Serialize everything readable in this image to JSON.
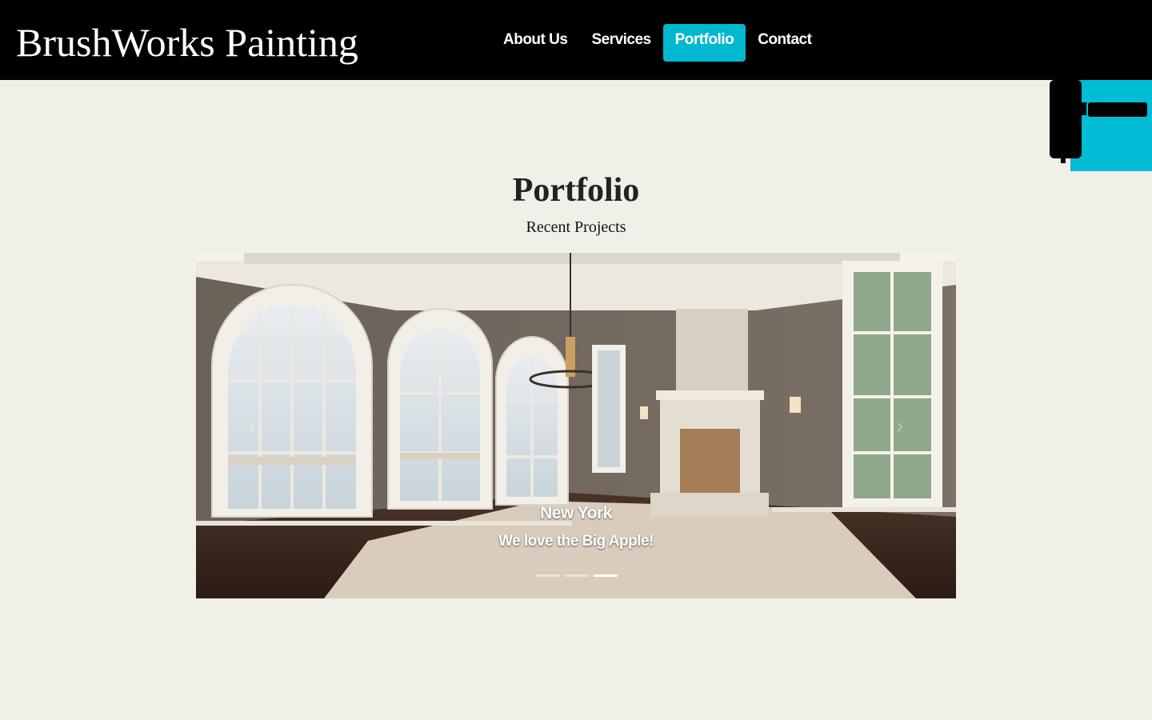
{
  "brand": {
    "name": "BrushWorks Painting"
  },
  "nav": {
    "items": [
      {
        "label": "About Us",
        "active": false
      },
      {
        "label": "Services",
        "active": false
      },
      {
        "label": "Portfolio",
        "active": true
      },
      {
        "label": "Contact",
        "active": false
      }
    ]
  },
  "header_icon": {
    "name": "paint-roller-icon",
    "panel_color": "#00bcd4"
  },
  "main": {
    "title": "Portfolio",
    "subtitle": "Recent Projects"
  },
  "carousel": {
    "slide": {
      "caption_title": "New York",
      "caption_text": "We love the Big Apple!"
    },
    "indicators_count": 3,
    "active_indicator": 3,
    "prev_icon": "chevron-left-icon",
    "next_icon": "chevron-right-icon"
  },
  "colors": {
    "navbar": "#000000",
    "accent": "#00b8cf",
    "page_background": "#f0efe8"
  }
}
